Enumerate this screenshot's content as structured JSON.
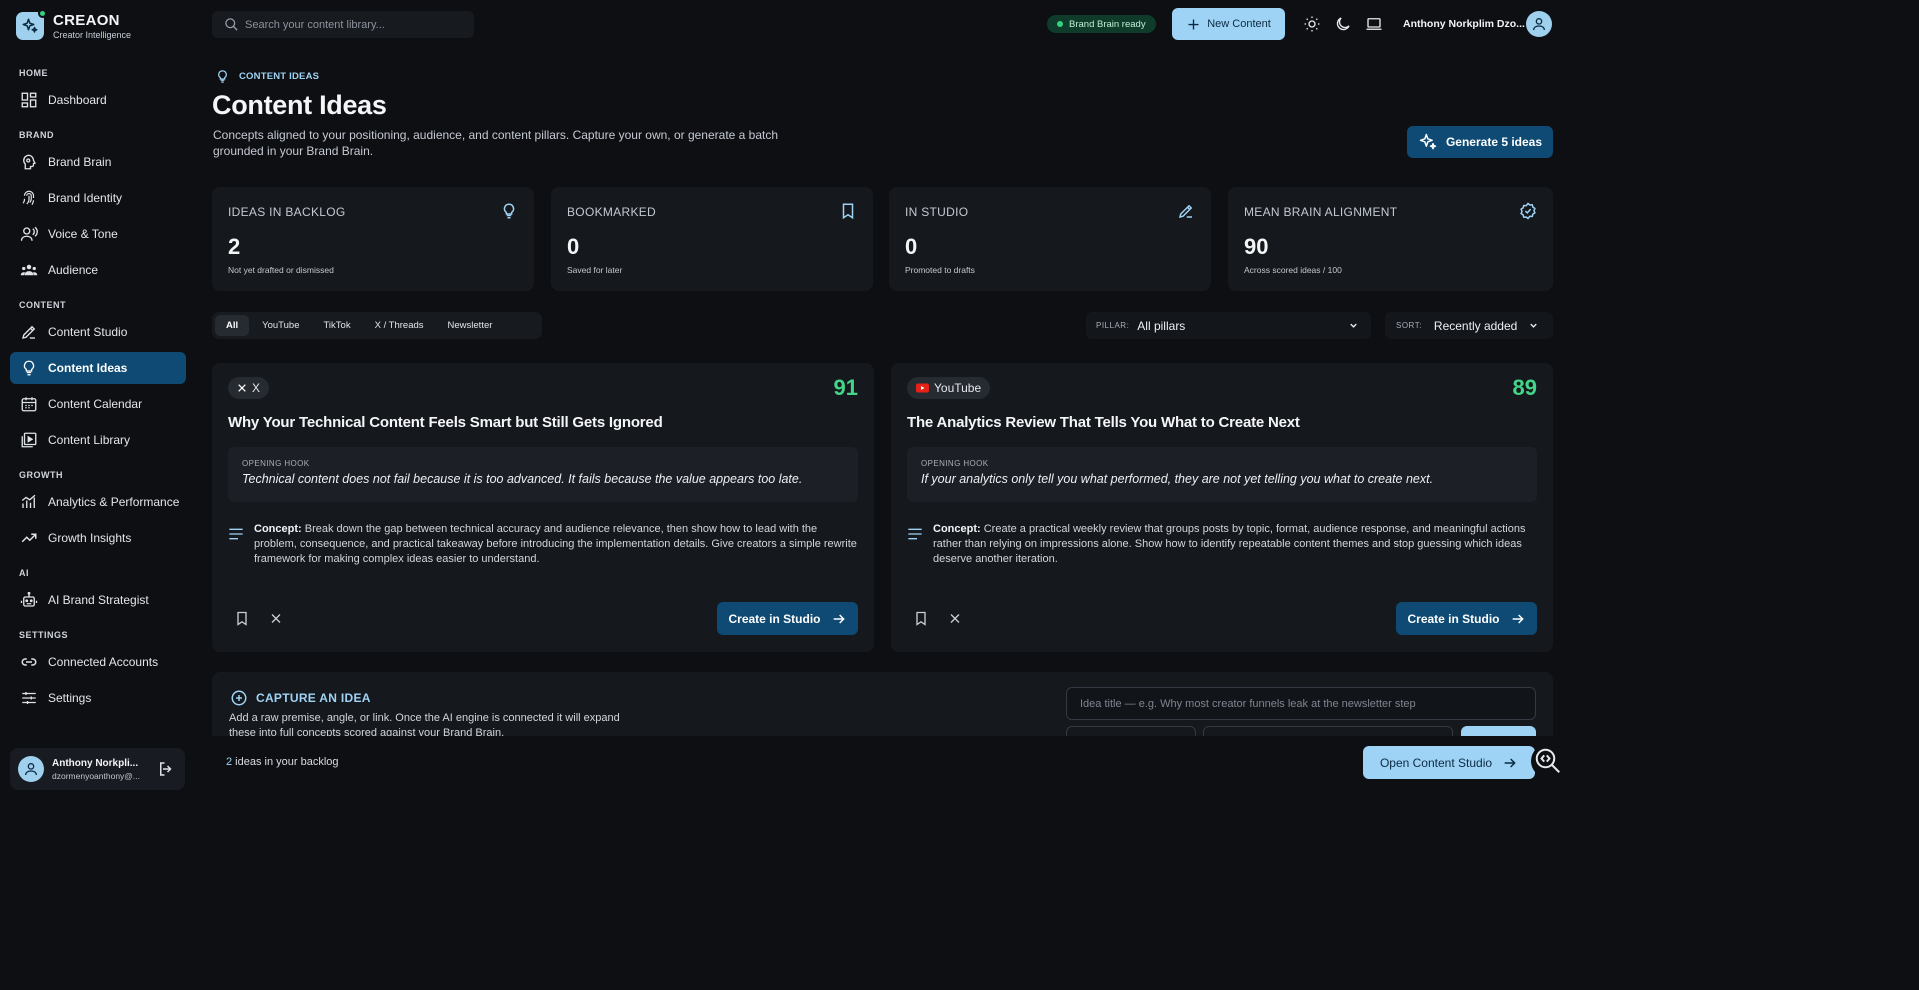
{
  "brand": {
    "name": "CREAON",
    "tagline": "Creator Intelligence"
  },
  "search": {
    "placeholder": "Search your content library..."
  },
  "topbar": {
    "status": "Brand Brain ready",
    "new_content": "New Content",
    "user_name": "Anthony Norkplim Dzo..."
  },
  "sidebar": {
    "sections": [
      "HOME",
      "BRAND",
      "CONTENT",
      "GROWTH",
      "AI",
      "SETTINGS"
    ],
    "items": [
      {
        "label": "Dashboard",
        "icon": "dashboard-icon"
      },
      {
        "label": "Brand Brain",
        "icon": "brain-icon"
      },
      {
        "label": "Brand Identity",
        "icon": "fingerprint-icon"
      },
      {
        "label": "Voice & Tone",
        "icon": "voice-icon"
      },
      {
        "label": "Audience",
        "icon": "audience-icon"
      },
      {
        "label": "Content Studio",
        "icon": "pen-icon"
      },
      {
        "label": "Content Ideas",
        "icon": "lightbulb-icon",
        "active": true
      },
      {
        "label": "Content Calendar",
        "icon": "calendar-icon"
      },
      {
        "label": "Content Library",
        "icon": "library-icon"
      },
      {
        "label": "Analytics & Performance",
        "icon": "analytics-icon"
      },
      {
        "label": "Growth Insights",
        "icon": "trending-icon"
      },
      {
        "label": "AI Brand Strategist",
        "icon": "robot-icon"
      },
      {
        "label": "Connected Accounts",
        "icon": "link-icon"
      },
      {
        "label": "Settings",
        "icon": "sliders-icon"
      }
    ],
    "user": {
      "name": "Anthony Norkpli...",
      "email": "dzormenyoanthony@..."
    }
  },
  "header": {
    "eyebrow": "CONTENT IDEAS",
    "title": "Content Ideas",
    "description": "Concepts aligned to your positioning, audience, and content pillars. Capture your own, or generate a batch grounded in your Brand Brain.",
    "generate": "Generate 5 ideas"
  },
  "stats": [
    {
      "label": "IDEAS IN BACKLOG",
      "value": "2",
      "sub": "Not yet drafted or dismissed",
      "icon": "lightbulb-icon"
    },
    {
      "label": "BOOKMARKED",
      "value": "0",
      "sub": "Saved for later",
      "icon": "bookmark-icon"
    },
    {
      "label": "IN STUDIO",
      "value": "0",
      "sub": "Promoted to drafts",
      "icon": "pen-icon"
    },
    {
      "label": "MEAN BRAIN ALIGNMENT",
      "value": "90",
      "sub": "Across scored ideas / 100",
      "icon": "verified-icon"
    }
  ],
  "filters": {
    "tabs": [
      "All",
      "YouTube",
      "TikTok",
      "X / Threads",
      "Newsletter"
    ],
    "active_tab": "All",
    "pillar_label": "PILLAR:",
    "pillar_value": "All pillars",
    "sort_label": "SORT:",
    "sort_value": "Recently added"
  },
  "ideas": [
    {
      "platform": "X",
      "score": "91",
      "title": "Why Your Technical Content Feels Smart but Still Gets Ignored",
      "hook_label": "OPENING HOOK",
      "hook": "Technical content does not fail because it is too advanced. It fails because the value appears too late.",
      "concept_label": "Concept:",
      "concept": " Break down the gap between technical accuracy and audience relevance, then show how to lead with the problem, consequence, and practical takeaway before introducing the implementation details. Give creators a simple rewrite framework for making complex ideas easier to understand.",
      "action": "Create in Studio"
    },
    {
      "platform": "YouTube",
      "score": "89",
      "title": "The Analytics Review That Tells You What to Create Next",
      "hook_label": "OPENING HOOK",
      "hook": "If your analytics only tell you what performed, they are not yet telling you what to create next.",
      "concept_label": "Concept:",
      "concept": " Create a practical weekly review that groups posts by topic, format, audience response, and meaningful actions rather than relying on impressions alone. Show how to identify repeatable content themes and stop guessing which ideas deserve another iteration.",
      "action": "Create in Studio"
    }
  ],
  "capture": {
    "title": "CAPTURE AN IDEA",
    "description": "Add a raw premise, angle, or link. Once the AI engine is connected it will expand these into full concepts scored against your Brand Brain.",
    "title_placeholder": "Idea title — e.g. Why most creator funnels leak at the newsletter step"
  },
  "footer": {
    "count": "2",
    "count_text": " ideas in your backlog",
    "open_studio": "Open Content Studio"
  }
}
